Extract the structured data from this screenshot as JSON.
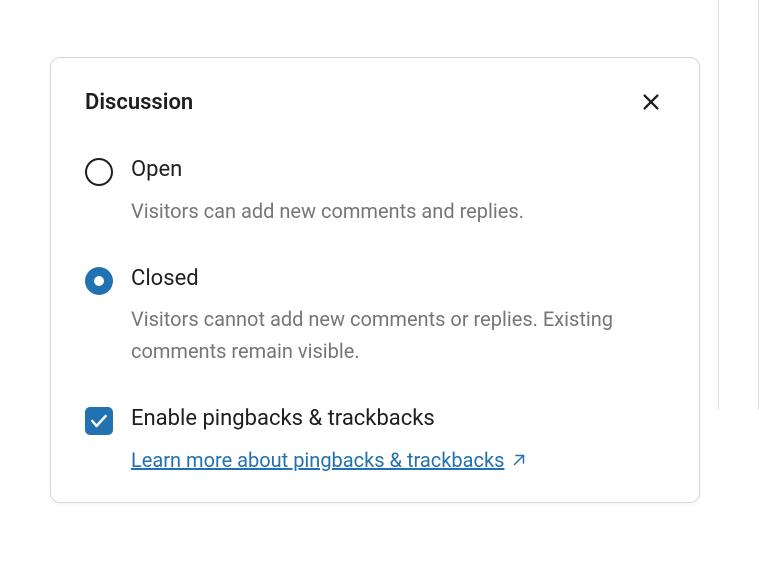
{
  "panel": {
    "title": "Discussion",
    "options": [
      {
        "label": "Open",
        "description": "Visitors can add new comments and replies.",
        "selected": false
      },
      {
        "label": "Closed",
        "description": "Visitors cannot add new comments or replies. Existing comments remain visible.",
        "selected": true
      }
    ],
    "checkbox": {
      "label": "Enable pingbacks & trackbacks",
      "checked": true
    },
    "link": {
      "text": "Learn more about pingbacks & trackbacks"
    }
  }
}
